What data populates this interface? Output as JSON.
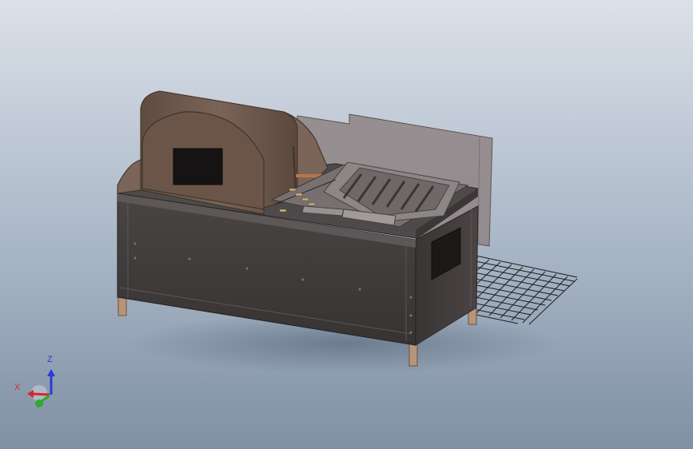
{
  "viewport": {
    "background_top": "#dbe1e9",
    "background_bottom": "#7f90a5"
  },
  "colors": {
    "enclosure_dark": "#3f3b3b",
    "enclosure_edge": "#5b5555",
    "hood_brown": "#6e5a4d",
    "panel_gray": "#8f8685",
    "leg_tan": "#b89479",
    "triad_x": "#d02a2a",
    "triad_y": "#2eaa2e",
    "triad_z": "#2a3bd8"
  },
  "triad": {
    "x_label": "X",
    "z_label": "Z",
    "x_icon": "x-axis-arrow-icon",
    "y_icon": "y-axis-arrow-icon",
    "z_icon": "z-axis-arrow-icon"
  },
  "model": {
    "parts": [
      "enclosure-cabinet",
      "arched-hood",
      "back-panel",
      "tray-assembly",
      "wire-mesh",
      "support-legs"
    ]
  }
}
